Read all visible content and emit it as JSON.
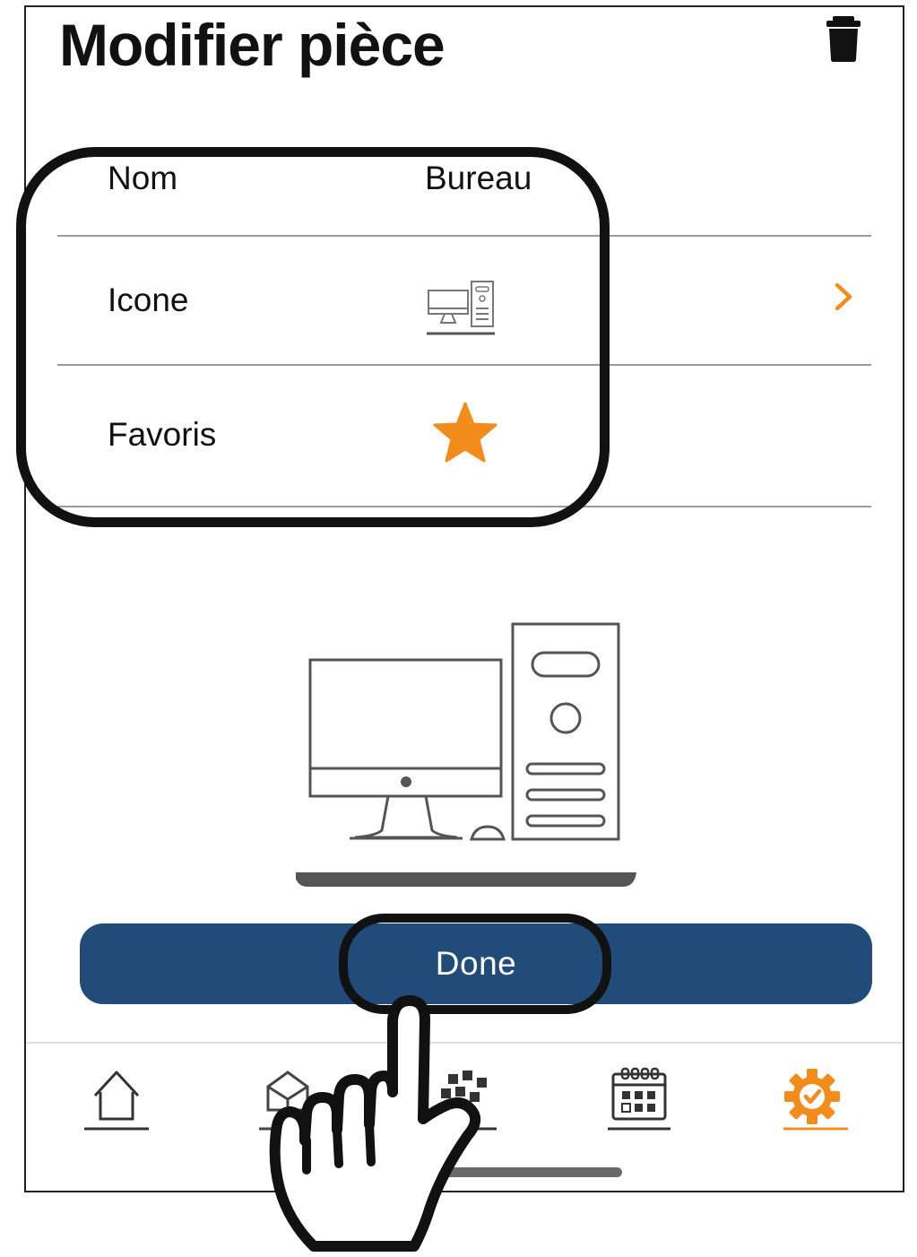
{
  "header": {
    "title": "Modifier pièce",
    "delete_icon": "trash-icon"
  },
  "form": {
    "rows": [
      {
        "label": "Nom",
        "value": "Bureau"
      },
      {
        "label": "Icone",
        "value_icon": "desktop-computer-icon",
        "action_icon": "chevron-right-icon"
      },
      {
        "label": "Favoris",
        "value_icon": "star-icon",
        "favorite": true
      }
    ]
  },
  "preview": {
    "icon": "desktop-computer-icon"
  },
  "done_button": {
    "label": "Done"
  },
  "bottom_nav": {
    "items": [
      {
        "icon": "home-icon",
        "active": false
      },
      {
        "icon": "rooms-icon",
        "active": false
      },
      {
        "icon": "devices-grid-icon",
        "active": false
      },
      {
        "icon": "calendar-icon",
        "active": false
      },
      {
        "icon": "settings-check-icon",
        "active": true
      }
    ]
  },
  "overlay": {
    "pointer": "hand-pointer-icon"
  },
  "colors": {
    "accent": "#f28c1c",
    "primary_button": "#214b78",
    "divider": "#9a9a9a",
    "text": "#111111",
    "active_nav": "#f28c1c"
  }
}
